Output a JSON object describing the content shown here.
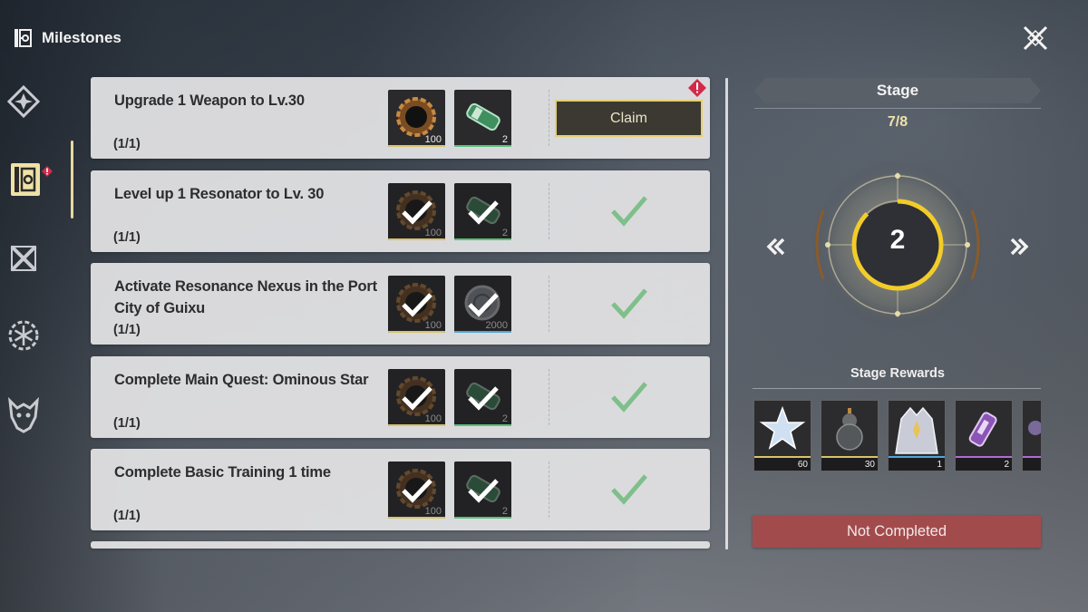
{
  "header": {
    "title": "Milestones",
    "icon": "milestones-icon"
  },
  "close": {
    "icon": "close-x-icon"
  },
  "nav": [
    {
      "name": "nav-diamond",
      "icon": "diamond-star-icon",
      "active": false
    },
    {
      "name": "nav-milestones",
      "icon": "milestones-icon",
      "active": true,
      "badge": true
    },
    {
      "name": "nav-crossed",
      "icon": "crossed-swords-icon",
      "active": false
    },
    {
      "name": "nav-snowflake",
      "icon": "snowflake-gear-icon",
      "active": false
    },
    {
      "name": "nav-mask",
      "icon": "dragon-mask-icon",
      "active": false
    }
  ],
  "tasks": [
    {
      "title": "Upgrade 1 Weapon to Lv.30",
      "progress": "(1/1)",
      "state": "claimable",
      "rewards": [
        {
          "icon": "gear-ring-icon",
          "qty": "100",
          "quality": "#d9c36a"
        },
        {
          "icon": "capsule-icon",
          "qty": "2",
          "quality": "#59c27a"
        }
      ],
      "claim_label": "Claim"
    },
    {
      "title": "Level up 1 Resonator to Lv. 30",
      "progress": "(1/1)",
      "state": "claimed",
      "rewards": [
        {
          "icon": "gear-ring-icon",
          "qty": "100",
          "quality": "#d9c36a"
        },
        {
          "icon": "capsule-icon",
          "qty": "2",
          "quality": "#59c27a"
        }
      ]
    },
    {
      "title": "Activate Resonance Nexus in the Port City of Guixu",
      "progress": "(1/1)",
      "state": "claimed",
      "rewards": [
        {
          "icon": "gear-ring-icon",
          "qty": "100",
          "quality": "#d9c36a"
        },
        {
          "icon": "coin-icon",
          "qty": "2000",
          "quality": "#4fa6d6"
        }
      ]
    },
    {
      "title": "Complete Main Quest: Ominous Star",
      "progress": "(1/1)",
      "state": "claimed",
      "rewards": [
        {
          "icon": "gear-ring-icon",
          "qty": "100",
          "quality": "#d9c36a"
        },
        {
          "icon": "capsule-icon",
          "qty": "2",
          "quality": "#59c27a"
        }
      ]
    },
    {
      "title": "Complete Basic Training 1 time",
      "progress": "(1/1)",
      "state": "claimed",
      "rewards": [
        {
          "icon": "gear-ring-icon",
          "qty": "100",
          "quality": "#d9c36a"
        },
        {
          "icon": "capsule-icon",
          "qty": "2",
          "quality": "#59c27a"
        }
      ]
    }
  ],
  "stage": {
    "title": "Stage",
    "count": "7/8",
    "current": "2",
    "progress_fraction": 0.875,
    "prev_icon": "double-chevron-left-icon",
    "next_icon": "double-chevron-right-icon"
  },
  "stage_rewards": {
    "title": "Stage Rewards",
    "items": [
      {
        "icon": "astrite-crystal-icon",
        "qty": "60",
        "quality": "#d9c36a"
      },
      {
        "icon": "gourd-icon",
        "qty": "30",
        "quality": "#d9c36a"
      },
      {
        "icon": "echo-figure-icon",
        "qty": "1",
        "quality": "#4fa6d6"
      },
      {
        "icon": "vial-icon",
        "qty": "2",
        "quality": "#b469d6"
      },
      {
        "icon": "partial-item-icon",
        "qty": "",
        "quality": "#b469d6"
      }
    ]
  },
  "status": {
    "label": "Not Completed",
    "color": "#a24b4d"
  }
}
